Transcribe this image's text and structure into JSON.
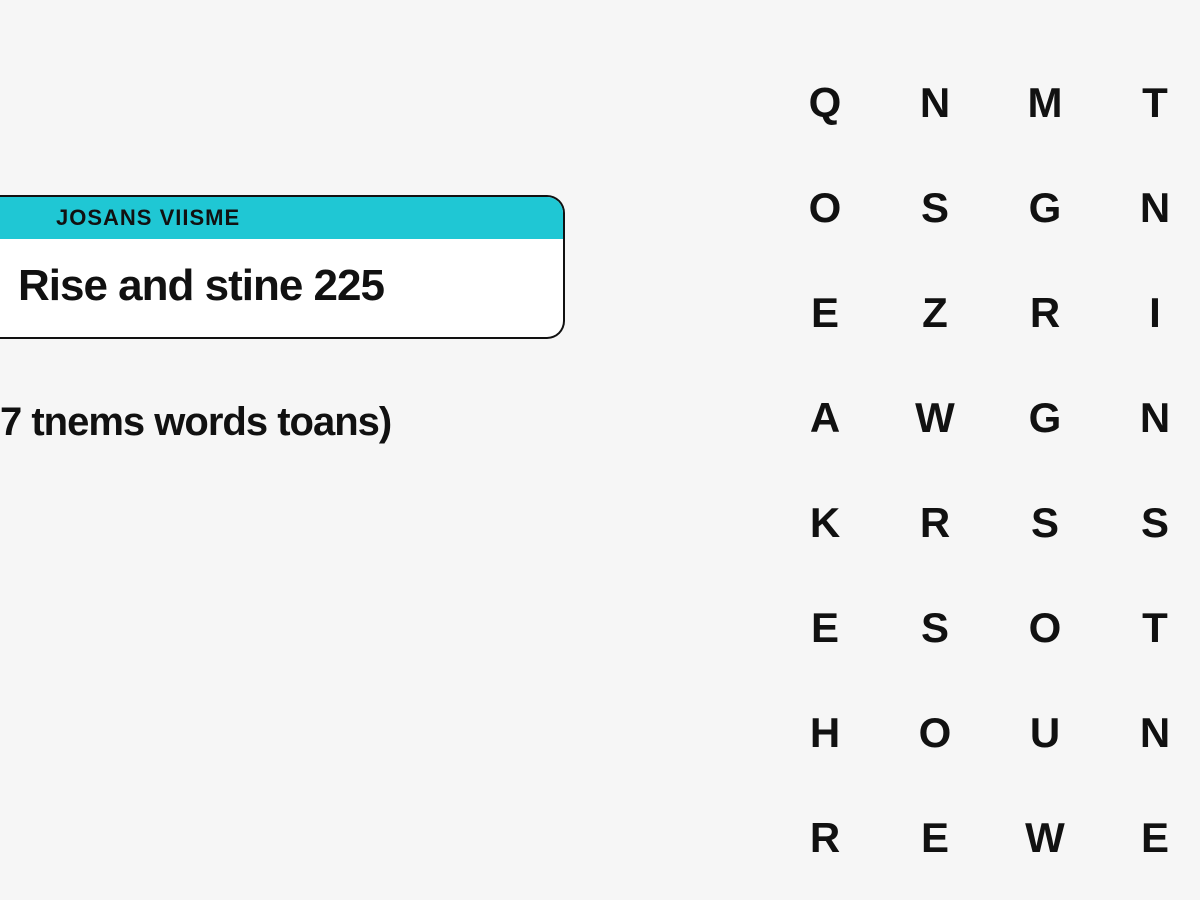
{
  "card": {
    "header": "JOSANS VIISME",
    "title": "Rise and stine 225"
  },
  "subtitle": "7 tnems words toans)",
  "grid": {
    "rows": [
      [
        "Q",
        "N",
        "M",
        "T"
      ],
      [
        "O",
        "S",
        "G",
        "N"
      ],
      [
        "E",
        "Z",
        "R",
        "I"
      ],
      [
        "A",
        "W",
        "G",
        "N"
      ],
      [
        "K",
        "R",
        "S",
        "S"
      ],
      [
        "E",
        "S",
        "O",
        "T"
      ],
      [
        "H",
        "O",
        "U",
        "N"
      ],
      [
        "R",
        "E",
        "W",
        "E"
      ]
    ]
  }
}
